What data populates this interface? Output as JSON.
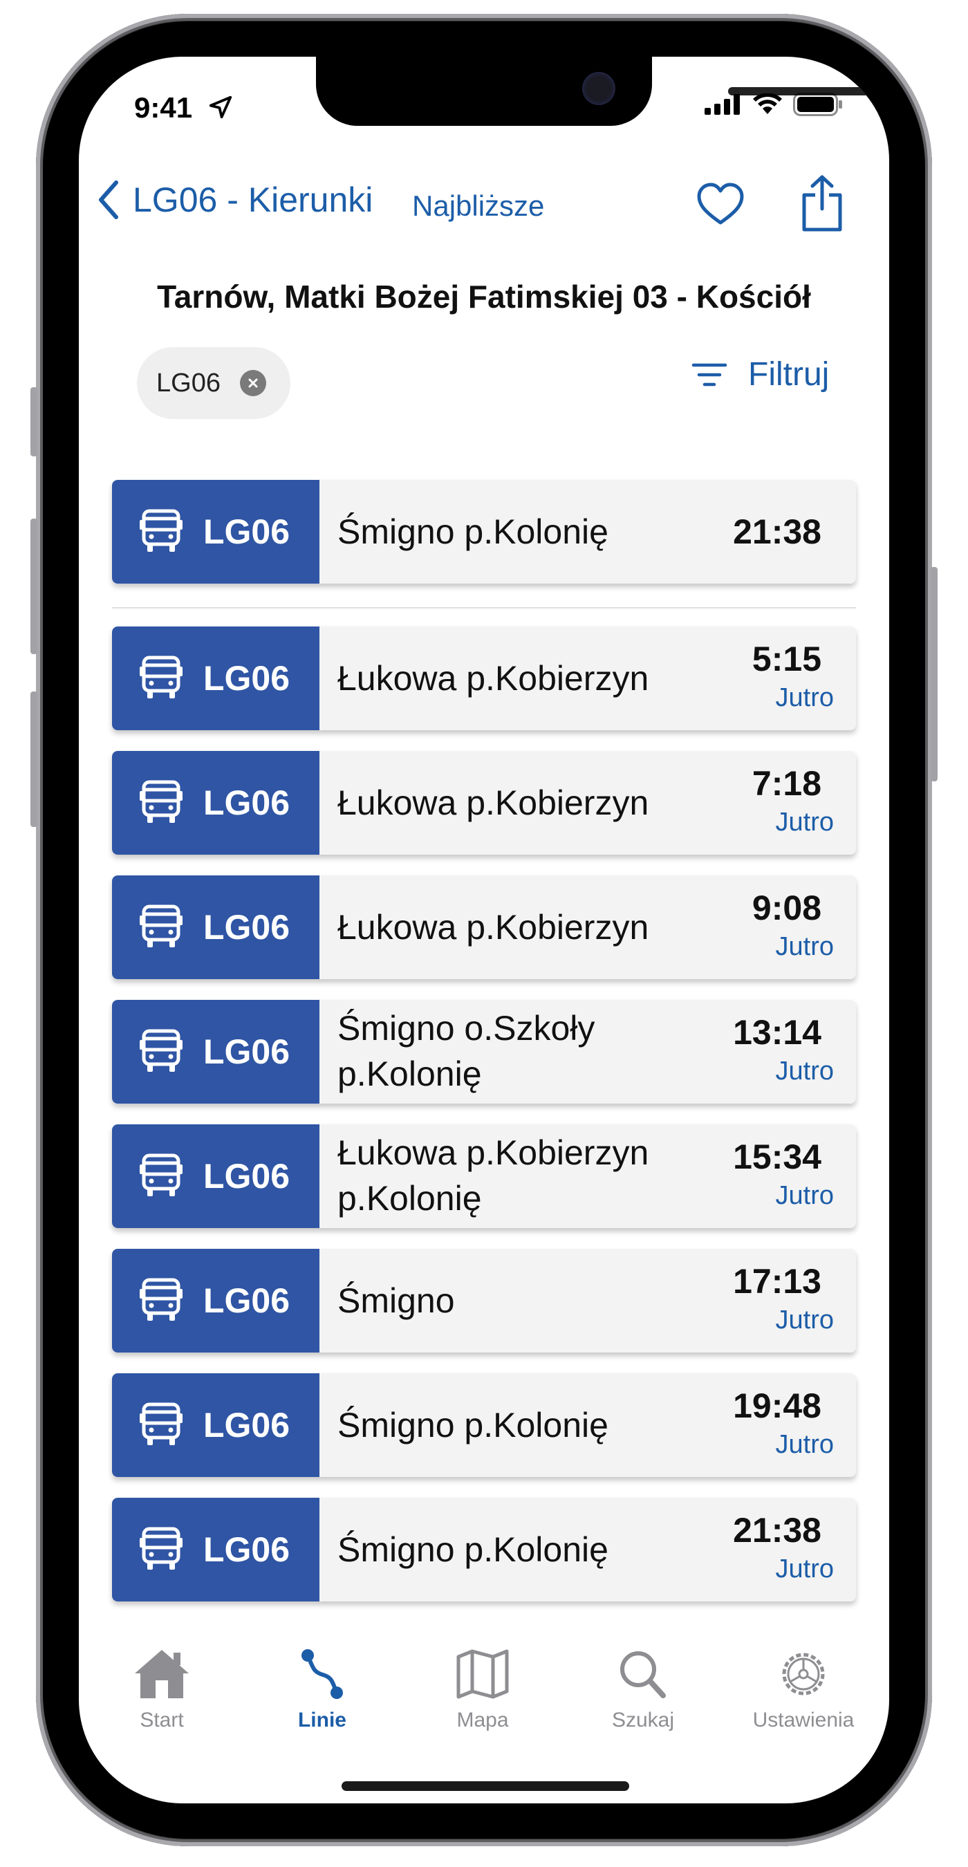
{
  "status_bar": {
    "time": "9:41"
  },
  "nav": {
    "back_title": "LG06 - Kierunki",
    "nearest_label": "Najbliższe"
  },
  "stop": {
    "title": "Tarnów, Matki Bożej Fatimskiej 03 - Kościół"
  },
  "filter_chip": {
    "label": "LG06"
  },
  "filter": {
    "label": "Filtruj"
  },
  "departures": [
    {
      "line": "LG06",
      "destination": "Śmigno p.Kolonię",
      "time": "21:38",
      "day": ""
    },
    {
      "line": "LG06",
      "destination": "Łukowa p.Kobierzyn",
      "time": "5:15",
      "day": "Jutro"
    },
    {
      "line": "LG06",
      "destination": "Łukowa p.Kobierzyn",
      "time": "7:18",
      "day": "Jutro"
    },
    {
      "line": "LG06",
      "destination": "Łukowa p.Kobierzyn",
      "time": "9:08",
      "day": "Jutro"
    },
    {
      "line": "LG06",
      "destination": "Śmigno o.Szkoły p.Kolonię",
      "time": "13:14",
      "day": "Jutro"
    },
    {
      "line": "LG06",
      "destination": "Łukowa p.Kobierzyn p.Kolonię",
      "time": "15:34",
      "day": "Jutro"
    },
    {
      "line": "LG06",
      "destination": "Śmigno",
      "time": "17:13",
      "day": "Jutro"
    },
    {
      "line": "LG06",
      "destination": "Śmigno p.Kolonię",
      "time": "19:48",
      "day": "Jutro"
    },
    {
      "line": "LG06",
      "destination": "Śmigno p.Kolonię",
      "time": "21:38",
      "day": "Jutro"
    }
  ],
  "tabs": [
    {
      "label": "Start",
      "icon": "home-icon"
    },
    {
      "label": "Linie",
      "icon": "route-icon",
      "active": true
    },
    {
      "label": "Mapa",
      "icon": "map-icon"
    },
    {
      "label": "Szukaj",
      "icon": "search-icon"
    },
    {
      "label": "Ustawienia",
      "icon": "settings-icon"
    }
  ],
  "colors": {
    "accent": "#1c5da8",
    "badge": "#2f55a4",
    "row_bg": "#f3f3f3"
  }
}
